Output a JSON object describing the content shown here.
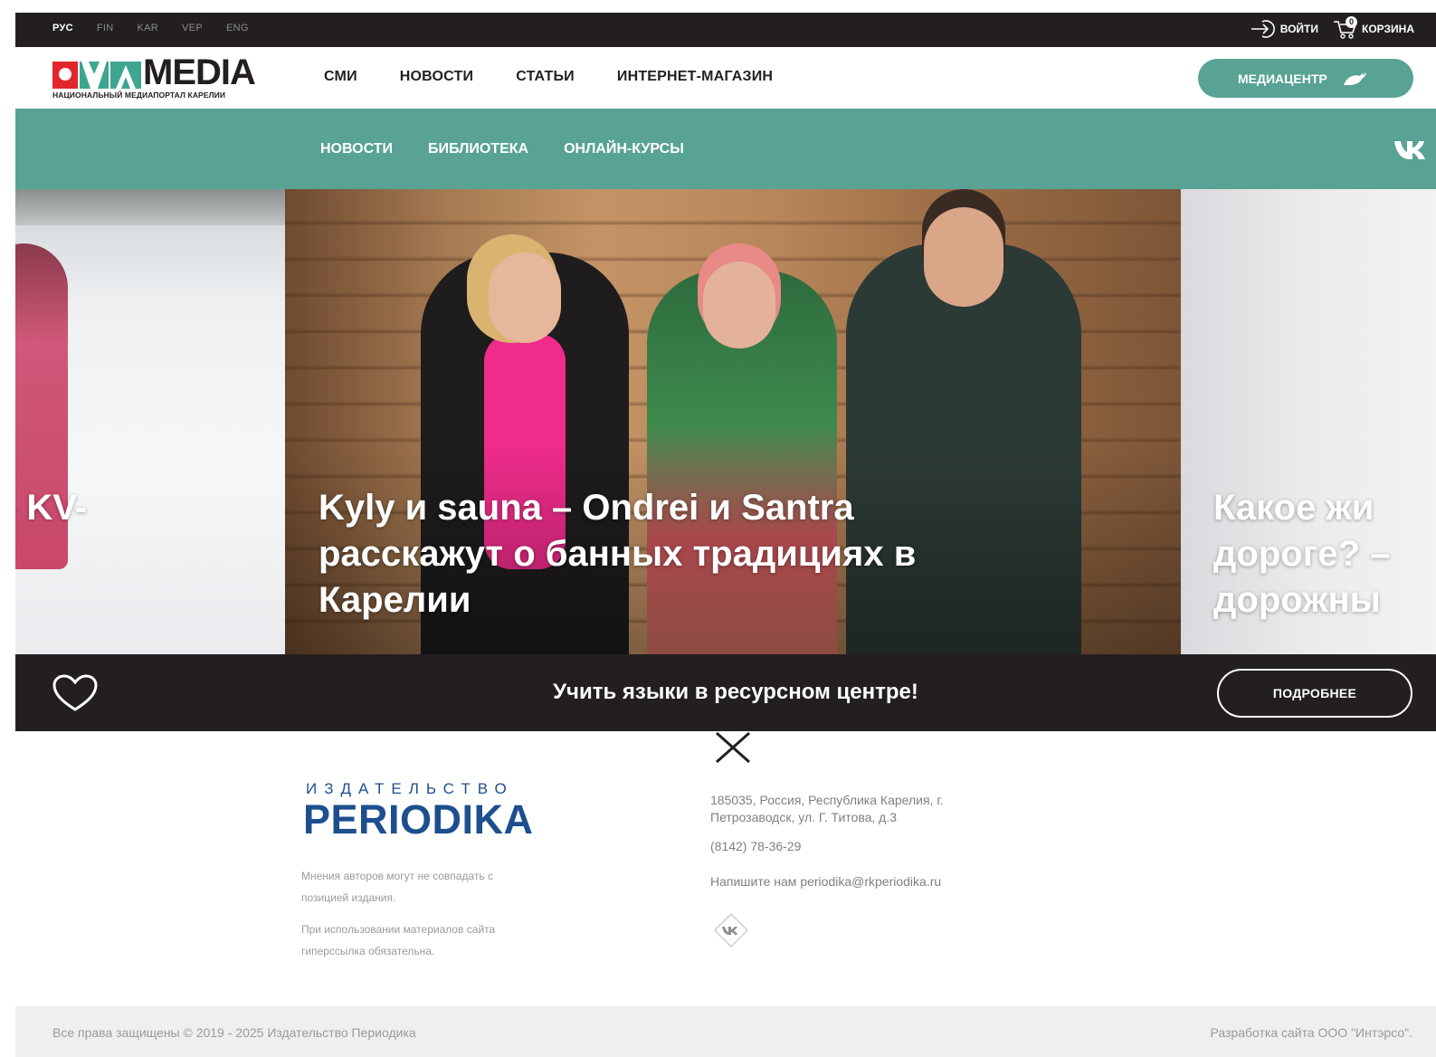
{
  "languages": [
    {
      "label": "РУС",
      "active": true
    },
    {
      "label": "FIN",
      "active": false
    },
    {
      "label": "KAR",
      "active": false
    },
    {
      "label": "VEP",
      "active": false
    },
    {
      "label": "ENG",
      "active": false
    }
  ],
  "topbar": {
    "login_label": "ВОЙТИ",
    "cart_label": "КОРЗИНА",
    "cart_count": "0"
  },
  "header": {
    "logo_text": "MEDIA",
    "logo_subtitle": "НАЦИОНАЛЬНЫЙ МЕДИАПОРТАЛ КАРЕЛИИ",
    "nav": [
      "СМИ",
      "НОВОСТИ",
      "СТАТЬИ",
      "ИНТЕРНЕТ-МАГАЗИН"
    ],
    "mediacenter_label": "МЕДИАЦЕНТР"
  },
  "subnav": {
    "links": [
      "НОВОСТИ",
      "БИБЛИОТЕКА",
      "ОНЛАЙН-КУРСЫ"
    ],
    "social_icon": "vk-icon"
  },
  "slider": {
    "prev_title": "- KV-",
    "current_title_lines": [
      "Kyly и sauna – Ondrei и Santra",
      "расскажут о банных традициях в",
      "Карелии"
    ],
    "next_title_lines": [
      "Какое жи",
      "дороге? –",
      "дорожны"
    ]
  },
  "promo": {
    "text": "Учить языки в ресурсном центре!",
    "button_label": "ПОДРОБНЕЕ",
    "icon": "heart-icon"
  },
  "footer": {
    "publisher_label": "ИЗДАТЕЛЬСТВО",
    "publisher_name": "PERIODIKA",
    "note1_lines": [
      "Мнения авторов могут не совпадать с",
      "позицией издания."
    ],
    "note2_lines": [
      "При использовании материалов сайта",
      "гиперссылка обязательна."
    ],
    "address_lines": [
      "185035, Россия, Республика Карелия, г.",
      "Петрозаводск, ул. Г. Титова, д.3"
    ],
    "phone": "(8142) 78-36-29",
    "email_text": "Напишите нам periodika@rkperiodika.ru",
    "copyright": "Все права защищены © 2019 - 2025 Издательство Периодика",
    "developer": "Разработка сайта ООО \"Интэрсо\"."
  },
  "colors": {
    "accent_green": "#58a393",
    "dark": "#231f20",
    "logo_red": "#e3262b",
    "logo_teal": "#3fa58e",
    "brand_blue": "#1d4f8f"
  }
}
